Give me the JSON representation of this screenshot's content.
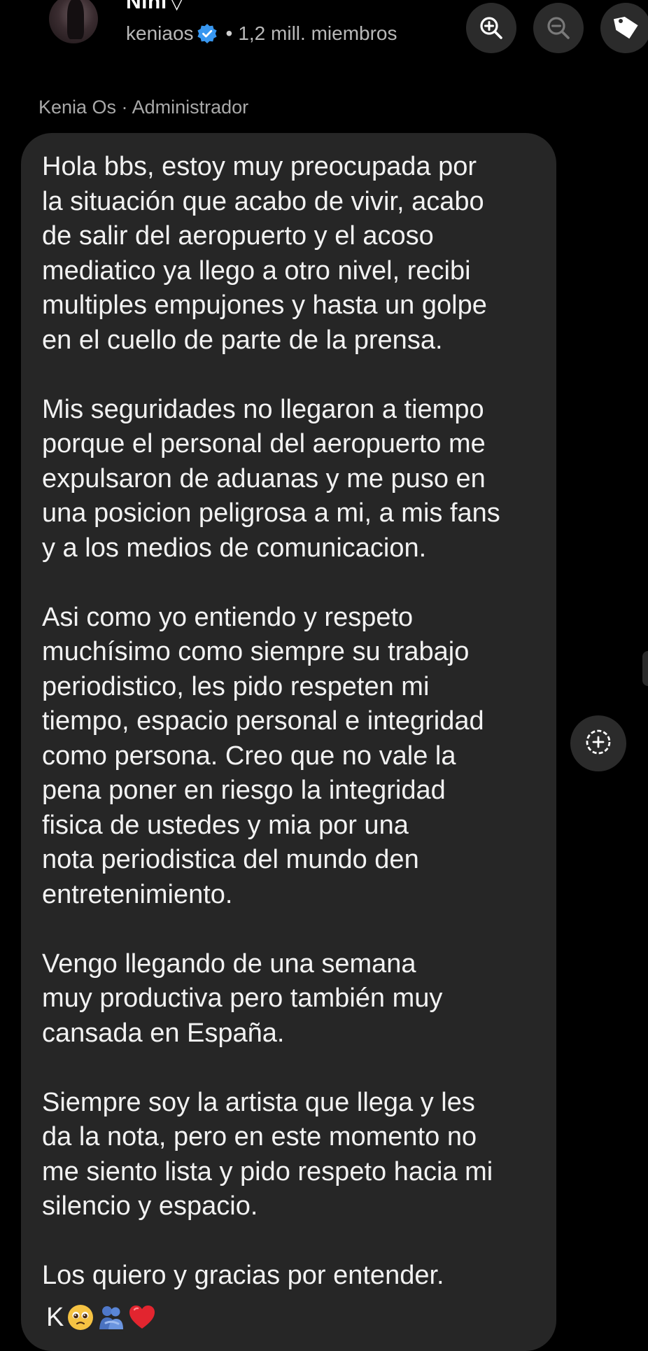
{
  "header": {
    "channel_name": "Nini",
    "channel_chevron": "▽",
    "username": "keniaos",
    "separator": "•",
    "members": "1,2 mill. miembros",
    "zoom_in_icon": "zoom-in-icon",
    "zoom_out_icon": "zoom-out-icon",
    "tag_icon": "tag-icon",
    "verified_color": "#3897f0"
  },
  "message": {
    "sender": "Kenia Os · Administrador",
    "paragraphs": [
      "Hola bbs, estoy muy preocupada por\nla situación que acabo de vivir, acabo\nde salir del aeropuerto y el acoso\nmediatico ya llego a otro nivel, recibi\nmultiples empujones y hasta un golpe\nen el cuello de parte de la prensa.",
      "Mis seguridades no llegaron a tiempo\nporque el personal del aeropuerto me\nexpulsaron de aduanas y me puso en\nuna posicion peligrosa a mi, a mis fans\ny a los medios de comunicacion.",
      "Asi como yo entiendo y respeto\nmuchísimo como siempre su trabajo\nperiodistico, les pido respeten mi\ntiempo, espacio personal e integridad\ncomo persona. Creo que no vale la\npena poner en riesgo la integridad\nfisica de ustedes y mia por una\nnota periodistica del mundo den\nentretenimiento.",
      "Vengo llegando de una semana\nmuy productiva pero también muy\ncansada en España.",
      "Siempre soy la artista que llega y les\nda la nota, pero en este momento no\nme siento lista y pido respeto hacia mi\nsilencio y espacio.",
      "Los quiero y gracias por entender."
    ],
    "signature": "K",
    "emojis": [
      "pleading-face-emoji",
      "people-hugging-emoji",
      "red-heart-emoji"
    ]
  },
  "actions": {
    "react_icon": "add-reaction-icon"
  },
  "colors": {
    "background": "#000000",
    "bubble": "#262626",
    "button": "#2b2b2b",
    "secondary_text": "#b9b9b9"
  }
}
